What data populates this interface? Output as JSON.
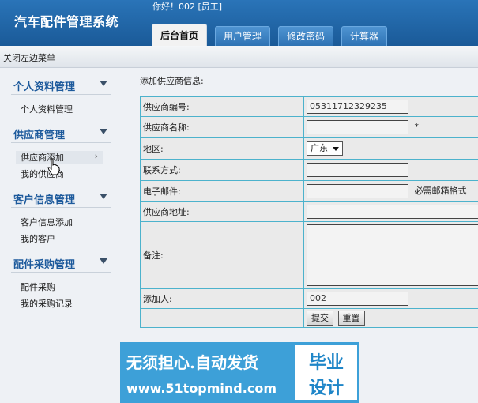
{
  "header": {
    "app_title": "汽车配件管理系统",
    "greeting": "你好！002 [员工]",
    "tabs": [
      {
        "label": "后台首页",
        "active": true
      },
      {
        "label": "用户管理",
        "active": false
      },
      {
        "label": "修改密码",
        "active": false
      },
      {
        "label": "计算器",
        "active": false
      }
    ]
  },
  "strip": {
    "toggle_menu": "关闭左边菜单"
  },
  "sidebar": {
    "sections": [
      {
        "title": "个人资料管理",
        "items": [
          "个人资料管理"
        ]
      },
      {
        "title": "供应商管理",
        "items": [
          "供应商添加",
          "我的供应商"
        ]
      },
      {
        "title": "客户信息管理",
        "items": [
          "客户信息添加",
          "我的客户"
        ]
      },
      {
        "title": "配件采购管理",
        "items": [
          "配件采购",
          "我的采购记录"
        ]
      }
    ],
    "hover_chevron": "›"
  },
  "main": {
    "title": "添加供应商信息:",
    "form": {
      "supplier_id": {
        "label": "供应商编号:",
        "value": "05311712329235"
      },
      "supplier_name": {
        "label": "供应商名称:",
        "value": "",
        "required_mark": "*"
      },
      "region": {
        "label": "地区:",
        "value": "广东"
      },
      "contact": {
        "label": "联系方式:",
        "value": ""
      },
      "email": {
        "label": "电子邮件:",
        "value": "",
        "hint": "必需邮箱格式"
      },
      "address": {
        "label": "供应商地址:",
        "value": ""
      },
      "note": {
        "label": "备注:",
        "value": ""
      },
      "added_by": {
        "label": "添加人:",
        "value": "002"
      },
      "submit_label": "提交",
      "reset_label": "重置"
    }
  },
  "banner": {
    "line1": "无须担心.自动发货",
    "line2": "www.51topmind.com",
    "right1": "毕业",
    "right2": "设计",
    "color": "#3da0d8"
  },
  "colors": {
    "header": "#2a74b8",
    "section_title": "#1d5a9c",
    "table_border": "#4cb2cc"
  }
}
